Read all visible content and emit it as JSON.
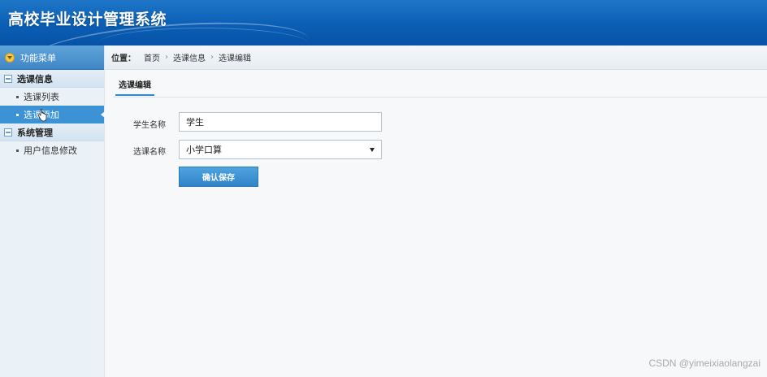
{
  "header": {
    "title": "高校毕业设计管理系统"
  },
  "sidebar": {
    "menu_header": "功能菜单",
    "groups": [
      {
        "title": "选课信息",
        "items": [
          {
            "label": "选课列表"
          },
          {
            "label": "选课添加",
            "active": true
          }
        ]
      },
      {
        "title": "系统管理",
        "items": [
          {
            "label": "用户信息修改"
          }
        ]
      }
    ]
  },
  "breadcrumb": {
    "prefix": "位置：",
    "items": [
      "首页",
      "选课信息",
      "选课编辑"
    ]
  },
  "tab": {
    "label": "选课编辑"
  },
  "form": {
    "student_label": "学生名称",
    "student_value": "学生",
    "course_label": "选课名称",
    "course_value": "小学口算",
    "save_label": "确认保存"
  },
  "watermark": "CSDN @yimeixiaolangzai",
  "colors": {
    "header": "#0a5fb5",
    "active": "#3b93d6",
    "button": "#2f84c8"
  }
}
